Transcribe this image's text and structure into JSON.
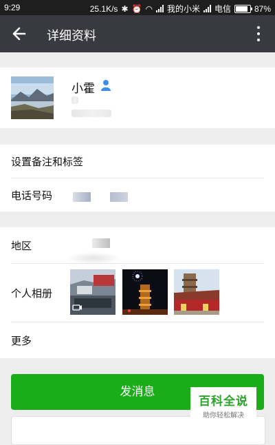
{
  "status_bar": {
    "time": "9:29",
    "net_speed": "25.1K/s",
    "carrier1": "我的小米",
    "carrier2": "电信",
    "battery": "87%"
  },
  "app_bar": {
    "title": "详细资料"
  },
  "profile": {
    "name": "小霍"
  },
  "rows": {
    "remark": "设置备注和标签",
    "phone": "电话号码",
    "region": "地区",
    "album": "个人相册",
    "more": "更多"
  },
  "actions": {
    "send_message": "发消息"
  },
  "watermark": {
    "title": "百科全说",
    "subtitle": "助你轻松解决"
  },
  "colors": {
    "primary": "#1aad19",
    "appbar": "#393a3f"
  }
}
